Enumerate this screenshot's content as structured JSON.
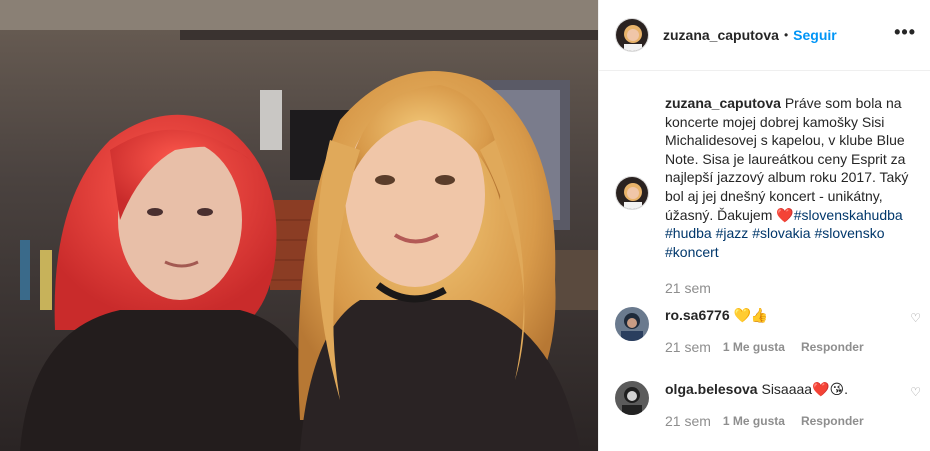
{
  "header": {
    "username": "zuzana_caputova",
    "separator": "•",
    "follow_label": "Seguir",
    "more_label": "•••"
  },
  "caption": {
    "username": "zuzana_caputova",
    "text": " Práve som bola na koncerte mojej dobrej kamošky Sisi Michalidesovej s kapelou, v klube Blue Note. Sisa je laureátkou ceny Esprit za najlepší jazzový album roku 2017. Taký bol aj jej dnešný koncert - unikátny, úžasný. Ďakujem ",
    "heart": "❤️",
    "hashtags": [
      "#slovenskahudba",
      "#hudba",
      "#jazz",
      "#slovakia",
      "#slovensko",
      "#koncert"
    ],
    "time": "21 sem"
  },
  "comments": [
    {
      "username": "ro.sa6776",
      "text": " 💛👍",
      "time": "21 sem",
      "likes_label": "1 Me gusta",
      "reply_label": "Responder",
      "like_icon": "♡"
    },
    {
      "username": "olga.belesova",
      "text": " Sisaaaa❤️😘.",
      "time": "21 sem",
      "likes_label": "1 Me gusta",
      "reply_label": "Responder",
      "like_icon": "♡"
    }
  ],
  "colors": {
    "accent": "#0095f6",
    "hashtag": "#00376b",
    "muted": "#8e8e8e",
    "border": "#efefef"
  }
}
